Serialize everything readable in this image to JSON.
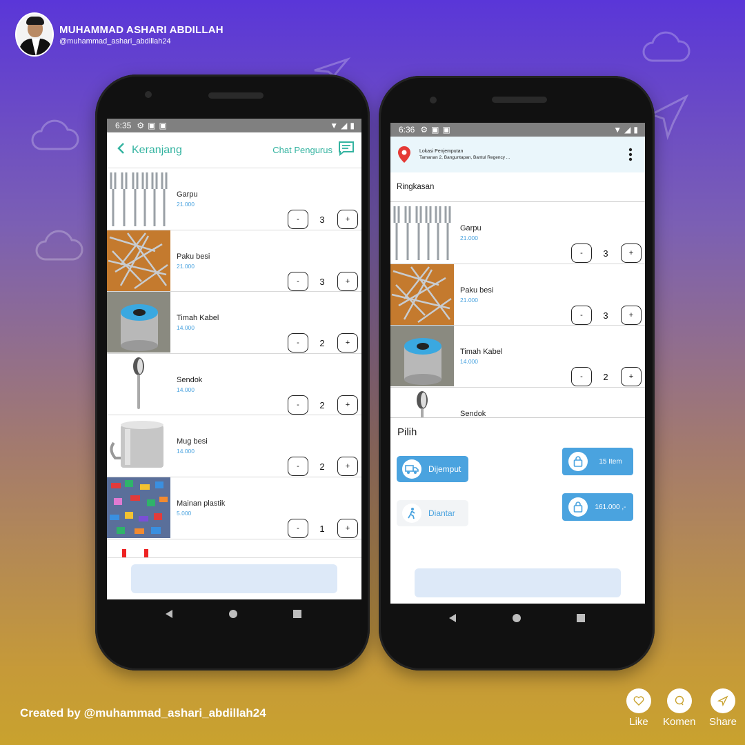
{
  "author": {
    "name": "MUHAMMAD ASHARI ABDILLAH",
    "handle": "@muhammad_ashari_abdillah24"
  },
  "credit": "Created by @muhammad_ashari_abdillah24",
  "social": {
    "like": "Like",
    "comment": "Komen",
    "share": "Share"
  },
  "phone1": {
    "time": "6:35",
    "header": {
      "title": "Keranjang",
      "chat": "Chat Pengurus"
    },
    "items": [
      {
        "name": "Garpu",
        "price": "21.000",
        "qty": "3",
        "minus": "-",
        "plus": "+"
      },
      {
        "name": "Paku besi",
        "price": "21.000",
        "qty": "3",
        "minus": "-",
        "plus": "+"
      },
      {
        "name": "Timah Kabel",
        "price": "14.000",
        "qty": "2",
        "minus": "-",
        "plus": "+"
      },
      {
        "name": "Sendok",
        "price": "14.000",
        "qty": "2",
        "minus": "-",
        "plus": "+"
      },
      {
        "name": "Mug besi",
        "price": "14.000",
        "qty": "2",
        "minus": "-",
        "plus": "+"
      },
      {
        "name": "Mainan plastik",
        "price": "5.000",
        "qty": "1",
        "minus": "-",
        "plus": "+"
      }
    ]
  },
  "phone2": {
    "time": "6:36",
    "location": {
      "title": "Lokasi Penjemputan",
      "address": "Tamanan 2, Banguntapan, Bantul Regency ..."
    },
    "summary_label": "Ringkasan",
    "items": [
      {
        "name": "Garpu",
        "price": "21.000",
        "qty": "3",
        "minus": "-",
        "plus": "+"
      },
      {
        "name": "Paku besi",
        "price": "21.000",
        "qty": "3",
        "minus": "-",
        "plus": "+"
      },
      {
        "name": "Timah Kabel",
        "price": "14.000",
        "qty": "2",
        "minus": "-",
        "plus": "+"
      },
      {
        "name": "Sendok"
      }
    ],
    "pilih": {
      "title": "Pilih",
      "pickup": "Dijemput",
      "delivery": "Diantar",
      "count": "15 Item",
      "total": "161.000 ,-"
    }
  },
  "colors": {
    "accent": "#4aa3df",
    "teal": "#33b3a0",
    "disabled_button": "#dde9f8"
  }
}
